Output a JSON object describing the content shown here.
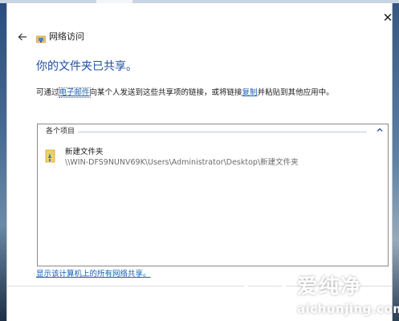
{
  "window": {
    "title": "网络访问",
    "close_icon": "close-icon",
    "back_icon": "back-arrow-icon"
  },
  "main": {
    "heading": "你的文件夹已共享。",
    "desc_before": "可通过",
    "email_link": "电子邮件",
    "desc_middle": "向某个人发送到这些共享项的链接，或将链接",
    "copy_link": "复制",
    "desc_after": "并粘贴到其他应用中。"
  },
  "list": {
    "group_header": "各个项目",
    "items": [
      {
        "name": "新建文件夹",
        "path": "\\\\WIN-DFS9NUNV69K\\Users\\Administrator\\Desktop\\新建文件夹"
      }
    ]
  },
  "footer": {
    "show_all_link": "显示该计算机上的所有网络共享。"
  },
  "watermark": {
    "cn": "爱纯净",
    "en": "aichunjing.com"
  },
  "colors": {
    "accent": "#1f4fa0",
    "link": "#1a5fb4"
  }
}
